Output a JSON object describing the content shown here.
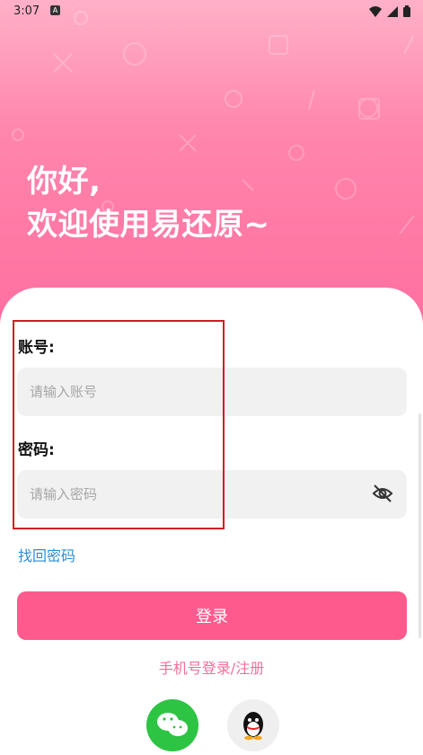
{
  "status": {
    "time": "3:07",
    "app_badge": "A"
  },
  "greeting": {
    "line1": "你好,",
    "line2": "欢迎使用易还原~"
  },
  "form": {
    "account_label": "账号:",
    "account_placeholder": "请输入账号",
    "password_label": "密码:",
    "password_placeholder": "请输入密码",
    "forgot": "找回密码",
    "login": "登录",
    "phone_login": "手机号登录/注册"
  },
  "colors": {
    "brand": "#ff5a8e",
    "link": "#2a8fd6",
    "wechat": "#2dc443"
  },
  "icons": [
    "wifi-icon",
    "signal-icon",
    "battery-icon",
    "eye-off-icon",
    "wechat-icon",
    "qq-icon"
  ]
}
